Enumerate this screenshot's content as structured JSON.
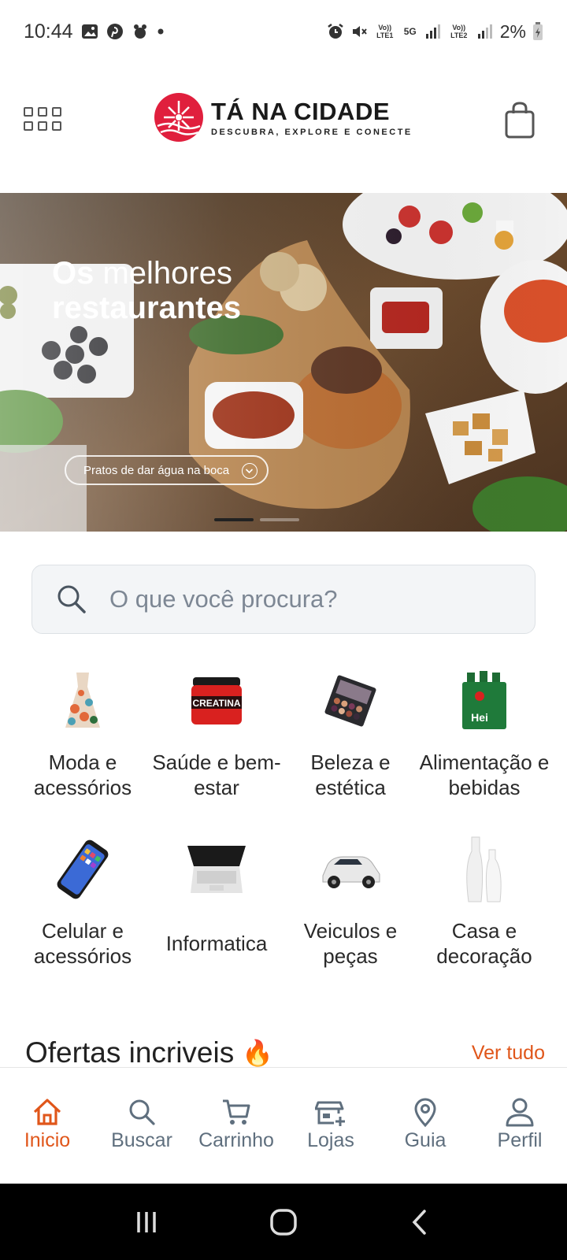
{
  "status_bar": {
    "time": "10:44",
    "left_icons": [
      "gallery-icon",
      "pinterest-icon",
      "bug-icon",
      "dot-icon"
    ],
    "right_icons": [
      "alarm-icon",
      "mute-icon",
      "volte-lte1-icon",
      "5g-icon",
      "signal-icon",
      "volte-lte2-icon",
      "signal-icon",
      "battery-icon"
    ],
    "lte1": "Vo)) LTE1",
    "net": "5G",
    "lte2": "Vo)) LTE2",
    "battery": "2%"
  },
  "header": {
    "logo_title": "TÁ NA CIDADE",
    "logo_subtitle": "DESCUBRA, EXPLORE E CONECTE",
    "menu_icon": "grid-menu-icon",
    "cart_icon": "shopping-bag-icon"
  },
  "banner": {
    "title_bold": "Os",
    "title_rest": " melhores",
    "title_line2": "restaurantes",
    "pill_label": "Pratos de dar água na boca",
    "slide_count": 2,
    "active_slide": 1
  },
  "search": {
    "placeholder": "O que você procura?"
  },
  "categories": [
    {
      "label": "Moda e acessórios",
      "icon": "dress-icon"
    },
    {
      "label": "Saúde e bem-estar",
      "icon": "supplement-jar-icon"
    },
    {
      "label": "Beleza e estética",
      "icon": "eyeshadow-palette-icon"
    },
    {
      "label": "Alimentação e bebidas",
      "icon": "beer-pack-icon"
    },
    {
      "label": "Celular e acessórios",
      "icon": "smartphone-icon"
    },
    {
      "label": "Informatica",
      "icon": "laptop-icon"
    },
    {
      "label": "Veiculos e peças",
      "icon": "car-icon"
    },
    {
      "label": "Casa e decoração",
      "icon": "vase-icon"
    }
  ],
  "offers": {
    "title": "Ofertas incriveis",
    "emoji": "🔥",
    "link": "Ver tudo"
  },
  "bottom_nav": [
    {
      "label": "Inicio",
      "icon": "home-icon",
      "active": true
    },
    {
      "label": "Buscar",
      "icon": "search-icon",
      "active": false
    },
    {
      "label": "Carrinho",
      "icon": "cart-icon",
      "active": false
    },
    {
      "label": "Lojas",
      "icon": "store-add-icon",
      "active": false
    },
    {
      "label": "Guia",
      "icon": "location-pin-icon",
      "active": false
    },
    {
      "label": "Perfil",
      "icon": "user-icon",
      "active": false
    }
  ],
  "colors": {
    "accent": "#e0561a",
    "brand_red": "#e01f3d",
    "nav_inactive": "#5f6f7e",
    "search_bg": "#f3f5f7"
  }
}
